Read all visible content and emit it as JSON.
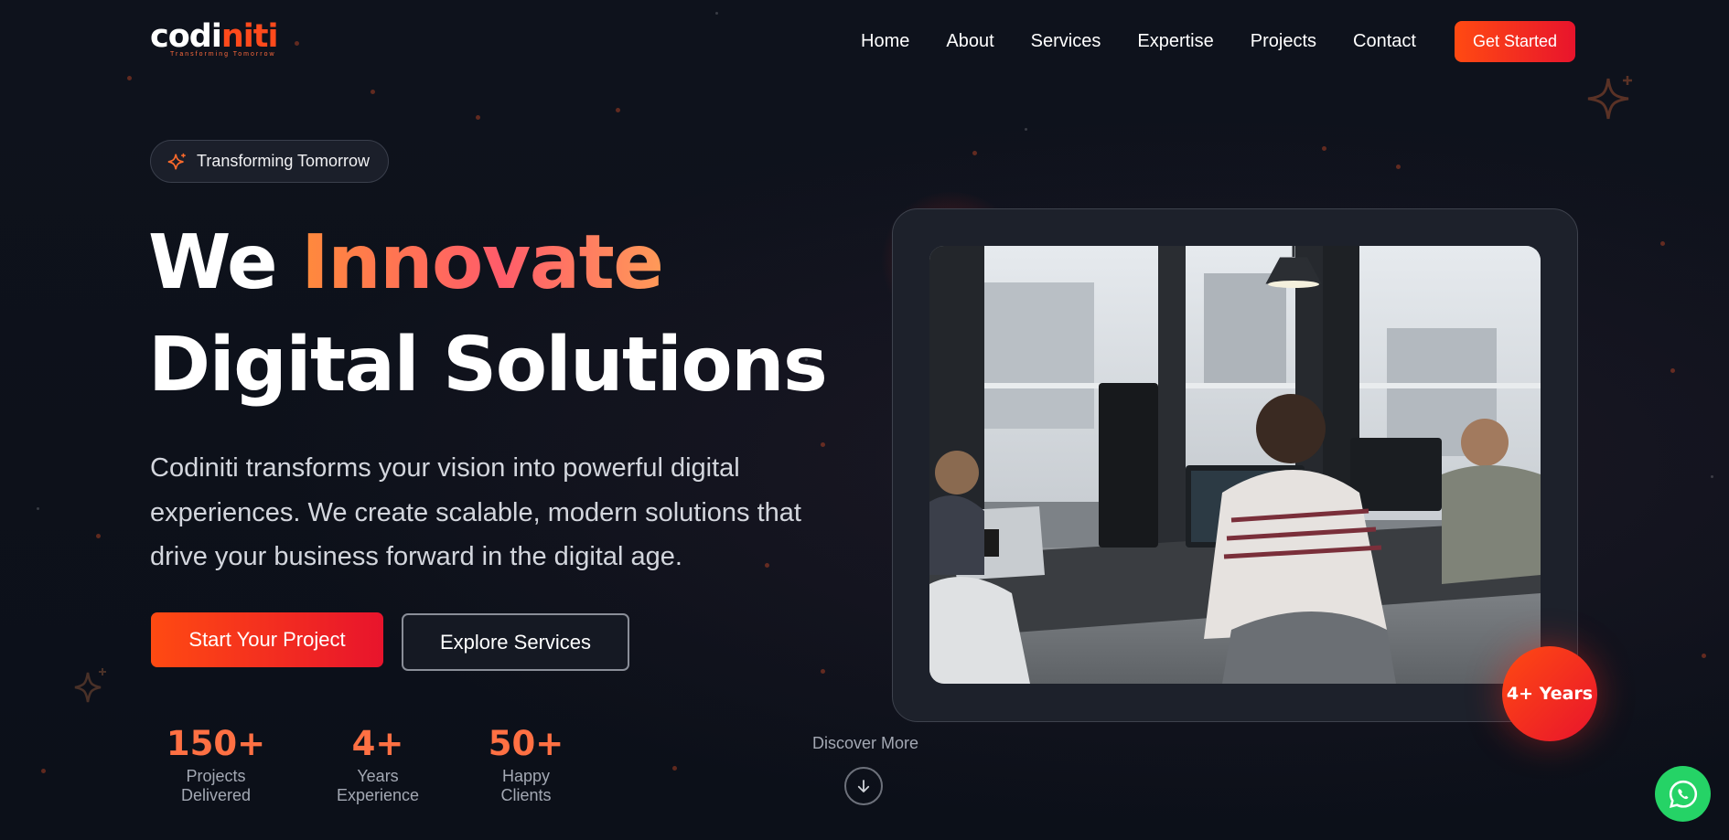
{
  "brand": {
    "logo_main": "codiniti",
    "logo_tagline": "Transforming Tomorrow"
  },
  "nav": {
    "links": [
      "Home",
      "About",
      "Services",
      "Expertise",
      "Projects",
      "Contact"
    ],
    "cta": "Get Started"
  },
  "hero": {
    "badge": "Transforming Tomorrow",
    "title_line1_plain": "We ",
    "title_line1_accent": "Innovate",
    "title_line2": "Digital Solutions",
    "description": "Codiniti transforms your vision into powerful digital experiences. We create scalable, modern solutions that drive your business forward in the digital age.",
    "primary_button": "Start Your Project",
    "secondary_button": "Explore Services"
  },
  "stats": [
    {
      "value": "150+",
      "label": "Projects Delivered"
    },
    {
      "value": "4+",
      "label": "Years Experience"
    },
    {
      "value": "50+",
      "label": "Happy Clients"
    }
  ],
  "discover": {
    "label": "Discover More"
  },
  "experience_badge": "4+ Years",
  "icons": {
    "badge": "sparkles-icon",
    "discover": "arrow-down-icon",
    "chat": "whatsapp-icon"
  },
  "colors": {
    "background": "#0d111b",
    "accent": "#ff4a12",
    "accent_end": "#e8142c",
    "stat": "#ff7043",
    "whatsapp": "#25d366"
  }
}
